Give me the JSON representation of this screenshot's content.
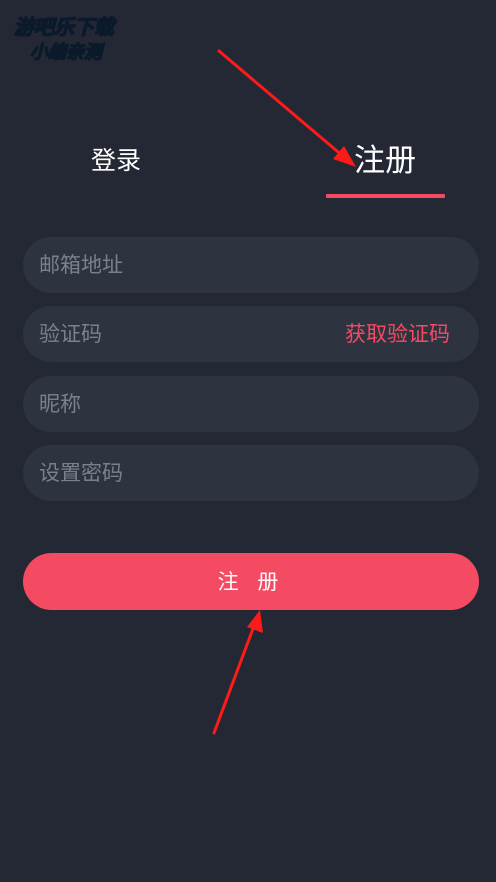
{
  "watermark": {
    "line1": "游吧乐下载",
    "line2": "小编亲测"
  },
  "tabs": {
    "login_label": "登录",
    "register_label": "注册",
    "active": "register"
  },
  "form": {
    "email_placeholder": "邮箱地址",
    "code_placeholder": "验证码",
    "get_code_label": "获取验证码",
    "nickname_placeholder": "昵称",
    "password_placeholder": "设置密码"
  },
  "submit": {
    "label": "注 册"
  },
  "colors": {
    "background": "#242834",
    "field_bg": "#2e3340",
    "accent": "#f44b63",
    "annotation_arrow": "#ff1a1a",
    "watermark_fill": "#17d6e8"
  }
}
